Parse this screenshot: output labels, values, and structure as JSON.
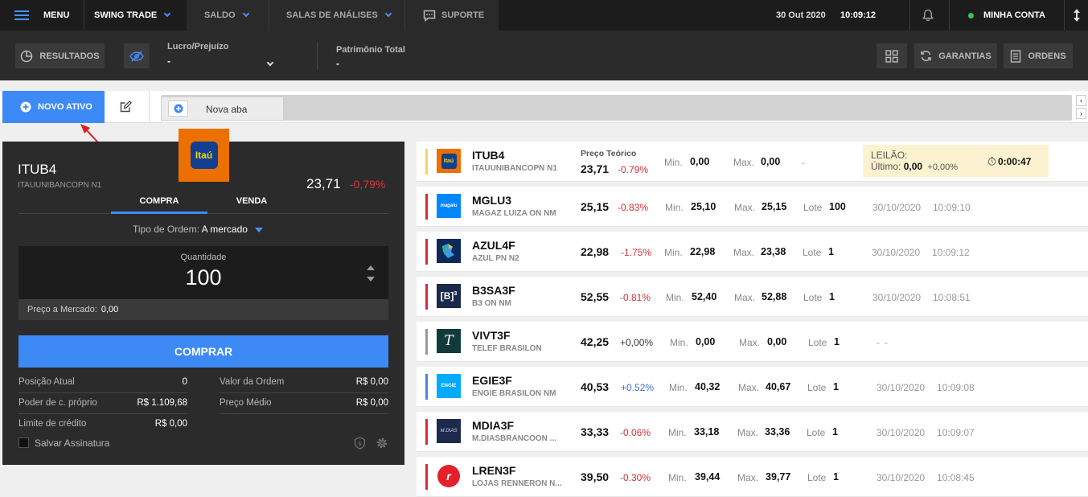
{
  "nav": {
    "menu_label": "MENU",
    "mode_label": "SWING TRADE",
    "saldo_label": "SALDO",
    "salas_label": "SALAS DE ANÁLISES",
    "suporte_label": "SUPORTE",
    "date": "30 Out 2020",
    "time": "10:09:12",
    "account_label": "MINHA CONTA"
  },
  "toolbar": {
    "resultados_label": "RESULTADOS",
    "lucro_label": "Lucro/Prejuízo",
    "lucro_value": "-",
    "patrimonio_label": "Patrimônio Total",
    "patrimonio_value": "-",
    "garantias_label": "GARANTIAS",
    "ordens_label": "ORDENS"
  },
  "tabs": {
    "novo_ativo_label": "NOVO ATIVO",
    "tab_label": "Nova aba"
  },
  "boleta": {
    "logo_text": "Itaú",
    "ticker": "ITUB4",
    "company": "ITAUUNIBANCOPN N1",
    "price": "23,71",
    "change": "-0,79%",
    "tab_buy": "COMPRA",
    "tab_sell": "VENDA",
    "order_type_label": "Tipo de Ordem:",
    "order_type_value": "A mercado",
    "qty_label": "Quantidade",
    "qty_value": "100",
    "market_price_label": "Preço a Mercado:",
    "market_price_value": "0,00",
    "buy_button": "COMPRAR",
    "posicao_label": "Posição Atual",
    "posicao_value": "0",
    "valor_ordem_label": "Valor da Ordem",
    "valor_ordem_value": "R$ 0,00",
    "poder_label": "Poder de c. próprio",
    "poder_value": "R$ 1.109,68",
    "preco_medio_label": "Preço Médio",
    "preco_medio_value": "R$ 0,00",
    "limite_label": "Limite de crédito",
    "limite_value": "R$ 0,00",
    "salvar_label": "Salvar Assinatura"
  },
  "colors": {
    "accent": "#3d8af7",
    "negative": "#d62d3a",
    "positive": "#3d6fd8",
    "nav_bg": "#1c1c1c",
    "panel_bg": "#2b2b2b",
    "auction_bg": "#fcf2cf"
  },
  "first_quote": {
    "ticker": "ITUB4",
    "company": "ITAUUNIBANCOPN N1",
    "teorico_label": "Preço Teórico",
    "price": "23,71",
    "change": "-0.79%",
    "min_label": "Min.",
    "min": "0,00",
    "max_label": "Max.",
    "max": "0,00",
    "dash": "-",
    "leilao_label": "LEILÃO:",
    "ultimo_label": "Último:",
    "ultimo_value": "0,00",
    "ultimo_change": "+0,00%",
    "timer": "0:00:47"
  },
  "quotes": [
    {
      "ticker": "MGLU3",
      "company": "MAGAZ LUIZA ON NM",
      "logo": "magalu-logo",
      "price": "25,15",
      "change": "-0.83%",
      "min_label": "Min.",
      "min": "25,10",
      "max_label": "Max.",
      "max": "25,15",
      "lote_label": "Lote",
      "lote": "100",
      "date": "30/10/2020",
      "time": "10:09:10"
    },
    {
      "ticker": "AZUL4F",
      "company": "AZUL PN N2",
      "logo": "azul-logo",
      "price": "22,98",
      "change": "-1.75%",
      "min_label": "Min.",
      "min": "22,98",
      "max_label": "Max.",
      "max": "23,38",
      "lote_label": "Lote",
      "lote": "1",
      "date": "30/10/2020",
      "time": "10:09:12"
    },
    {
      "ticker": "B3SA3F",
      "company": "B3 ON NM",
      "logo": "b3-logo",
      "price": "52,55",
      "change": "-0.81%",
      "min_label": "Min.",
      "min": "52,40",
      "max_label": "Max.",
      "max": "52,88",
      "lote_label": "Lote",
      "lote": "1",
      "date": "30/10/2020",
      "time": "10:08:51"
    },
    {
      "ticker": "VIVT3F",
      "company": "TELEF BRASILON",
      "logo": "vivo-logo",
      "price": "42,25",
      "change": "+0,00%",
      "min_label": "Min.",
      "min": "0,00",
      "max_label": "Max.",
      "max": "0,00",
      "lote_label": "Lote",
      "lote": "1",
      "date": "-",
      "time": "-"
    },
    {
      "ticker": "EGIE3F",
      "company": "ENGIE BRASILON NM",
      "logo": "engie-logo",
      "price": "40,53",
      "change": "+0.52%",
      "min_label": "Min.",
      "min": "40,32",
      "max_label": "Max.",
      "max": "40,67",
      "lote_label": "Lote",
      "lote": "1",
      "date": "30/10/2020",
      "time": "10:09:08"
    },
    {
      "ticker": "MDIA3F",
      "company": "M.DIASBRANCOON ...",
      "logo": "mdias-logo",
      "price": "33,33",
      "change": "-0.06%",
      "min_label": "Min.",
      "min": "33,18",
      "max_label": "Max.",
      "max": "33,36",
      "lote_label": "Lote",
      "lote": "1",
      "date": "30/10/2020",
      "time": "10:09:07"
    },
    {
      "ticker": "LREN3F",
      "company": "LOJAS RENNERON N...",
      "logo": "renner-logo",
      "price": "39,50",
      "change": "-0.30%",
      "min_label": "Min.",
      "min": "39,44",
      "max_label": "Max.",
      "max": "39,77",
      "lote_label": "Lote",
      "lote": "1",
      "date": "30/10/2020",
      "time": "10:08:45"
    }
  ]
}
